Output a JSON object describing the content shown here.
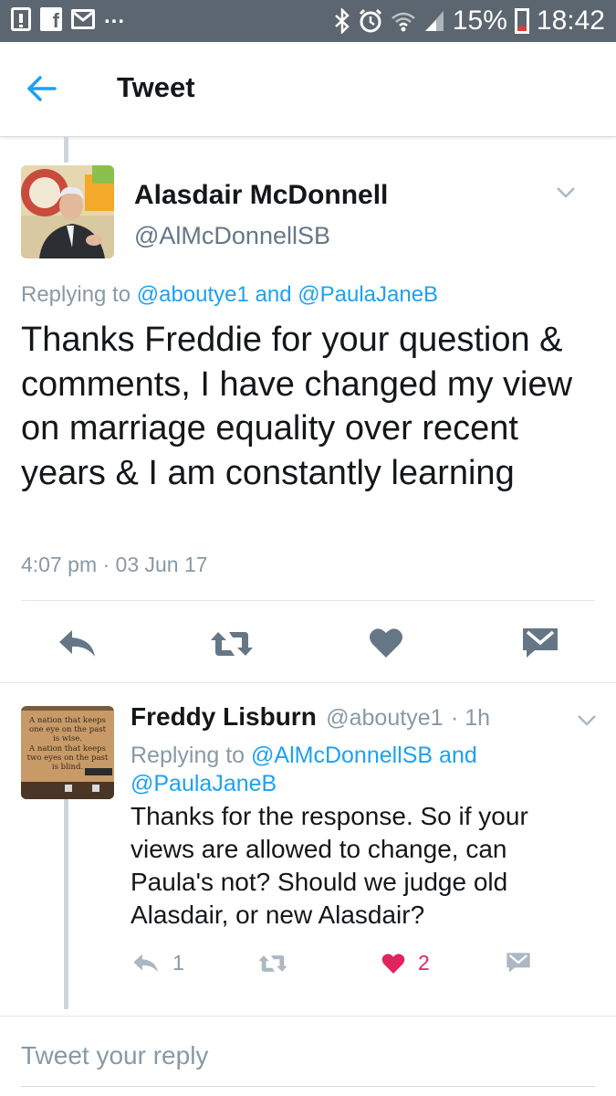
{
  "status_bar": {
    "left_icons": [
      "alert-icon",
      "facebook-icon",
      "mail-icon"
    ],
    "more": "...",
    "right_icons": [
      "bluetooth-icon",
      "alarm-icon",
      "wifi-icon",
      "signal-icon"
    ],
    "battery": "15%",
    "battery_level": 0.15,
    "time": "18:42"
  },
  "app_bar": {
    "back_icon": "arrow-left-icon",
    "title": "Tweet",
    "accent": "#1da1f2"
  },
  "main_tweet": {
    "name": "Alasdair McDonnell",
    "handle": "@AlMcDonnellSB",
    "replying_prefix": "Replying to",
    "replying_to": [
      "@aboutye1",
      "@PaulaJaneB"
    ],
    "replying_sep": "and",
    "text": "Thanks Freddie for your question & comments, I have changed my view on marriage equality over recent years & I am constantly learning",
    "timestamp": "4:07 pm · 03 Jun 17",
    "actions": [
      "reply-icon",
      "retweet-icon",
      "like-icon",
      "dm-icon"
    ]
  },
  "reply_tweet": {
    "name": "Freddy Lisburn",
    "handle": "@aboutye1",
    "time": "· 1h",
    "replying_prefix": "Replying to",
    "replying_to": [
      "@AlMcDonnellSB",
      "@PaulaJaneB"
    ],
    "replying_sep": "and",
    "text": "Thanks for the response. So if your views are allowed to change, can Paula's not? Should we judge old Alasdair, or new Alasdair?",
    "reply_count": "1",
    "like_count": "2",
    "liked": true,
    "like_color": "#e0245e",
    "avatar_text": [
      "A nation that keeps",
      "one eye on the past",
      "is wise.",
      "A nation that keeps",
      "two eyes on the past",
      "is blind."
    ]
  },
  "compose": {
    "placeholder": "Tweet your reply"
  }
}
